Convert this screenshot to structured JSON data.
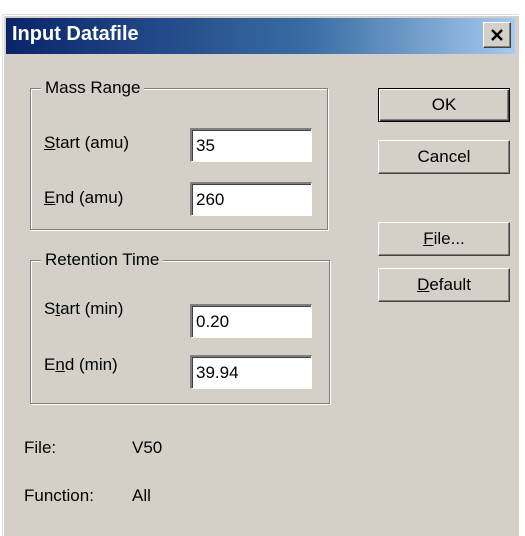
{
  "dialog": {
    "title": "Input Datafile",
    "close_icon": "close-icon"
  },
  "mass_range": {
    "legend": "Mass Range",
    "start_label_pre": "",
    "start_label_u": "S",
    "start_label_post": "tart (amu)",
    "start_value": "35",
    "end_label_pre": "",
    "end_label_u": "E",
    "end_label_post": "nd (amu)",
    "end_value": "260"
  },
  "retention_time": {
    "legend": "Retention Time",
    "start_label_pre": "S",
    "start_label_u": "t",
    "start_label_post": "art (min)",
    "start_value": "0.20",
    "end_label_pre": "E",
    "end_label_u": "n",
    "end_label_post": "d (min)",
    "end_value": "39.94"
  },
  "buttons": {
    "ok": "OK",
    "cancel": "Cancel",
    "file_u": "F",
    "file_post": "ile...",
    "default_u": "D",
    "default_post": "efault"
  },
  "info": {
    "file_label": "File:",
    "file_value": "V50",
    "function_label": "Function:",
    "function_value": "All"
  },
  "colors": {
    "title_start": "#0a246a",
    "title_end": "#a6caf0",
    "face": "#d4d0c8"
  }
}
